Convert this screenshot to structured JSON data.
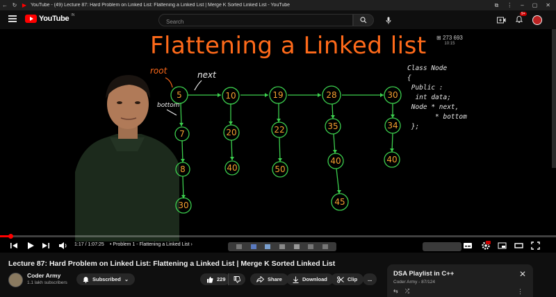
{
  "window": {
    "title": "YouTube - (49) Lecture 87: Hard Problem on Linked List: Flattening a Linked List | Merge K Sorted Linked List - YouTube"
  },
  "masthead": {
    "logo_text": "YouTube",
    "country_code": "IN",
    "search_placeholder": "Search",
    "notification_badge": "9+"
  },
  "video_frame": {
    "board_title": "Flattening  a  Linked list",
    "view_count": "273 693",
    "view_sub": "10:15",
    "code_lines": [
      "Class Node",
      "{",
      " Public :",
      "  int data;",
      " Node * next,",
      "       * bottom",
      " };"
    ],
    "annotations": {
      "root": "root",
      "next": "next",
      "bottom": "bottom"
    },
    "nodes": {
      "n5": "5",
      "n10": "10",
      "n19": "19",
      "n28": "28",
      "n30": "30",
      "n7": "7",
      "n8": "8",
      "n30b": "30",
      "n20": "20",
      "n40a": "40",
      "n22": "22",
      "n50": "50",
      "n35": "35",
      "n40b": "40",
      "n45": "45",
      "n34": "34",
      "n40c": "40"
    }
  },
  "player": {
    "time_current": "1:17",
    "time_total": "1:07:25",
    "chapter": "Problem 1 - Flattening a Linked List",
    "progress": 0.019
  },
  "video_info": {
    "title": "Lecture 87: Hard Problem on Linked List: Flattening a Linked List | Merge K Sorted Linked List",
    "channel_name": "Coder Army",
    "subscribers": "1.1 lakh subscribers",
    "subscribed_label": "Subscribed",
    "likes": "229",
    "share_label": "Share",
    "download_label": "Download",
    "clip_label": "Clip",
    "more_label": "..."
  },
  "playlist": {
    "title": "DSA Playlist in C++",
    "meta": "Coder Army - 87/124"
  }
}
